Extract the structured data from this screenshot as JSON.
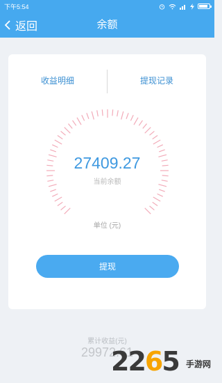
{
  "status_bar": {
    "time": "下午5:54",
    "battery_level": 0.85
  },
  "nav": {
    "back_label": "返回",
    "title": "余额"
  },
  "tabs": {
    "income_detail": "收益明细",
    "withdraw_record": "提现记录"
  },
  "balance": {
    "value": "27409.27",
    "label": "当前余额",
    "unit": "单位 (元)"
  },
  "withdraw_button": "提现",
  "total": {
    "label": "累计收益(元)",
    "value": "29972.61"
  },
  "watermark": {
    "logo_text": "2265",
    "site_text": "手游网"
  },
  "colors": {
    "primary": "#46a9ef",
    "gauge_tick": "#f2aab8",
    "link": "#3b8fd2"
  }
}
